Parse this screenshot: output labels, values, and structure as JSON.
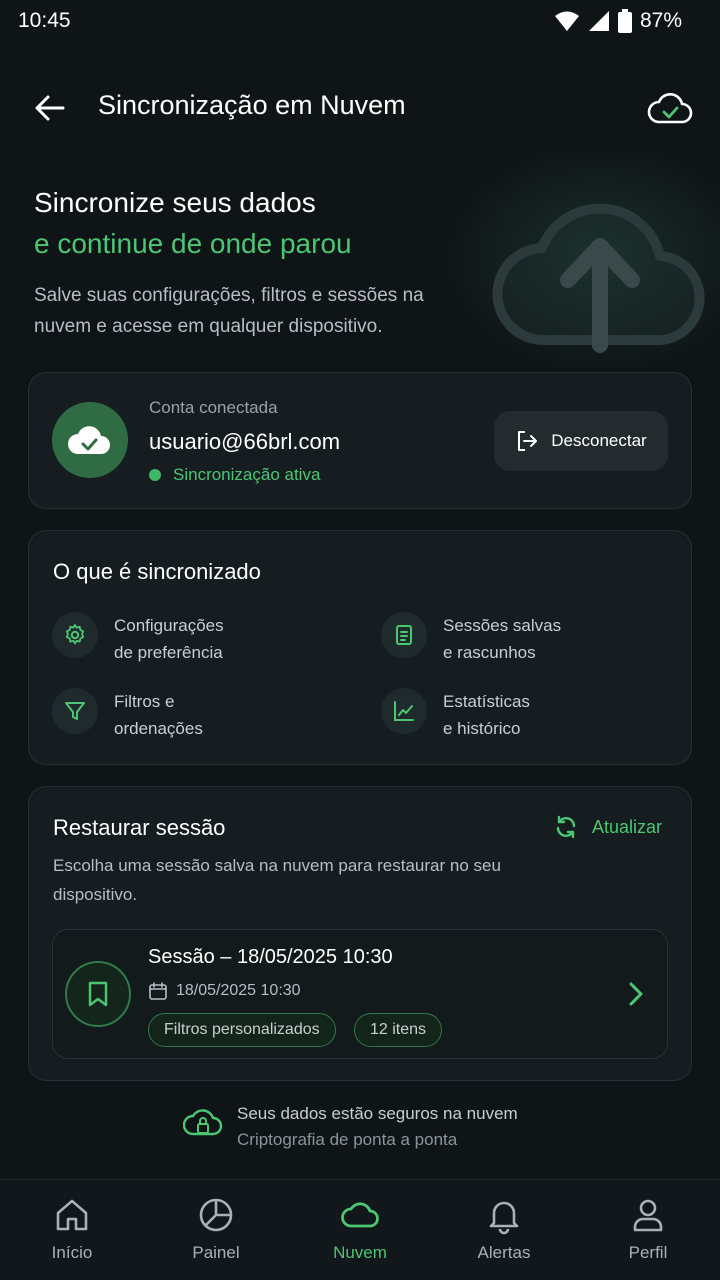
{
  "status_bar": {
    "time": "10:45",
    "battery": "87%"
  },
  "header": {
    "title": "Sincronização em Nuvem"
  },
  "hero": {
    "title_line1": "Sincronize seus dados",
    "title_line2": "e continue de onde parou",
    "description": "Salve suas configurações, filtros e sessões na nuvem e acesse em qualquer dispositivo."
  },
  "account": {
    "label": "Conta conectada",
    "email": "usuario@66brl.com",
    "status": "Sincronização ativa",
    "disconnect_label": "Desconectar"
  },
  "sync": {
    "title": "O que é sincronizado",
    "items": [
      {
        "line1": "Configurações",
        "line2": "de preferência",
        "icon": "gear-icon"
      },
      {
        "line1": "Sessões salvas",
        "line2": "e rascunhos",
        "icon": "document-icon"
      },
      {
        "line1": "Filtros e",
        "line2": "ordenações",
        "icon": "filter-icon"
      },
      {
        "line1": "Estatísticas",
        "line2": "e histórico",
        "icon": "chart-icon"
      }
    ]
  },
  "restore": {
    "title": "Restaurar sessão",
    "refresh_label": "Atualizar",
    "description": "Escolha uma sessão salva na nuvem para restaurar no seu dispositivo.",
    "session": {
      "title": "Sessão – 18/05/2025 10:30",
      "date": "18/05/2025 10:30",
      "tags": [
        "Filtros personalizados",
        "12 itens"
      ]
    }
  },
  "security": {
    "title": "Seus dados estão seguros na nuvem",
    "subtitle": "Criptografia de ponta a ponta"
  },
  "nav": {
    "items": [
      {
        "label": "Início",
        "icon": "home-icon"
      },
      {
        "label": "Painel",
        "icon": "pie-chart-icon"
      },
      {
        "label": "Nuvem",
        "icon": "cloud-icon",
        "active": true
      },
      {
        "label": "Alertas",
        "icon": "bell-icon"
      },
      {
        "label": "Perfil",
        "icon": "user-icon"
      }
    ]
  },
  "colors": {
    "accent": "#4cc672",
    "background": "#0f1416",
    "card": "#161d20"
  }
}
